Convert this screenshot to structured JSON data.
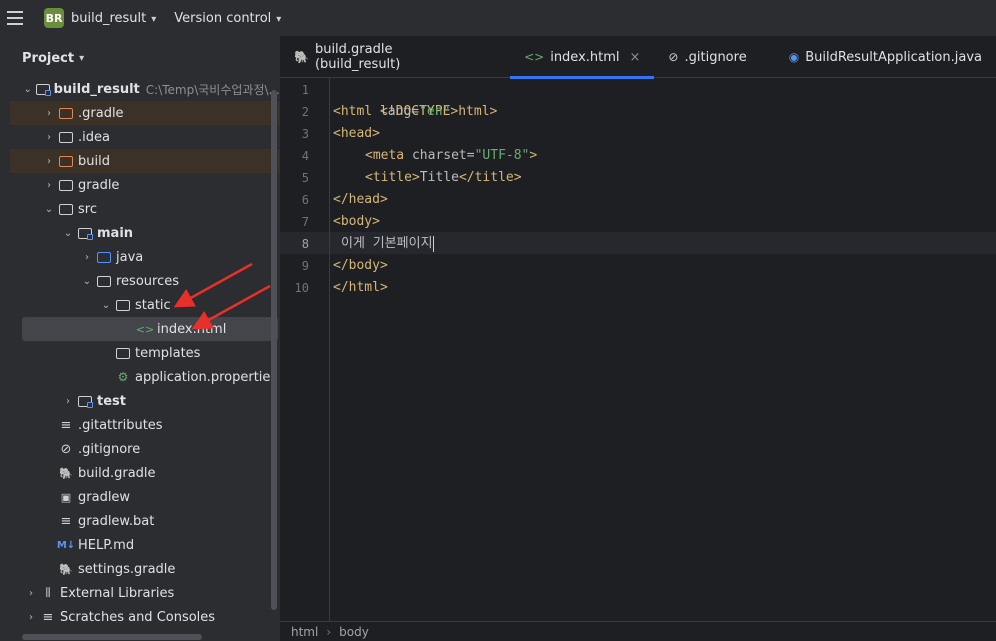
{
  "titlebar": {
    "badge": "BR",
    "project_name": "build_result",
    "vcs_label": "Version control"
  },
  "project_panel": {
    "title": "Project",
    "root": {
      "label": "build_result",
      "path": "C:\\Temp\\국비수업과정\\..."
    },
    "items": [
      {
        "label": ".gradle"
      },
      {
        "label": ".idea"
      },
      {
        "label": "build"
      },
      {
        "label": "gradle"
      },
      {
        "label": "src"
      },
      {
        "label": "main"
      },
      {
        "label": "java"
      },
      {
        "label": "resources"
      },
      {
        "label": "static"
      },
      {
        "label": "index.html"
      },
      {
        "label": "templates"
      },
      {
        "label": "application.properties"
      },
      {
        "label": "test"
      },
      {
        "label": ".gitattributes"
      },
      {
        "label": ".gitignore"
      },
      {
        "label": "build.gradle"
      },
      {
        "label": "gradlew"
      },
      {
        "label": "gradlew.bat"
      },
      {
        "label": "HELP.md"
      },
      {
        "label": "settings.gradle"
      },
      {
        "label": "External Libraries"
      },
      {
        "label": "Scratches and Consoles"
      }
    ]
  },
  "tabs": [
    {
      "label": "build.gradle (build_result)"
    },
    {
      "label": "index.html",
      "close": "×"
    },
    {
      "label": ".gitignore"
    },
    {
      "label": "BuildResultApplication.java"
    }
  ],
  "editor": {
    "line_numbers": [
      "1",
      "2",
      "3",
      "4",
      "5",
      "6",
      "7",
      "8",
      "9",
      "10"
    ],
    "lines": {
      "l1": {
        "t1": "<!DOCTYPE html>"
      },
      "l2": {
        "t1": "<html ",
        "a1": "lang",
        "eq": "=",
        "s1": "\"en\"",
        "t2": ">"
      },
      "l3": {
        "t1": "<head>"
      },
      "l4": {
        "t1": "<meta ",
        "a1": "charset",
        "eq": "=",
        "s1": "\"UTF-8\"",
        "t2": ">"
      },
      "l5": {
        "t1": "<title>",
        "x": "Title",
        "t2": "</title>"
      },
      "l6": {
        "t1": "</head>"
      },
      "l7": {
        "t1": "<body>"
      },
      "l8": {
        "x": "이게 기본페이지"
      },
      "l9": {
        "t1": "</body>"
      },
      "l10": {
        "t1": "</html>"
      }
    }
  },
  "statusbar": {
    "crumb1": "html",
    "crumb2": "body"
  }
}
